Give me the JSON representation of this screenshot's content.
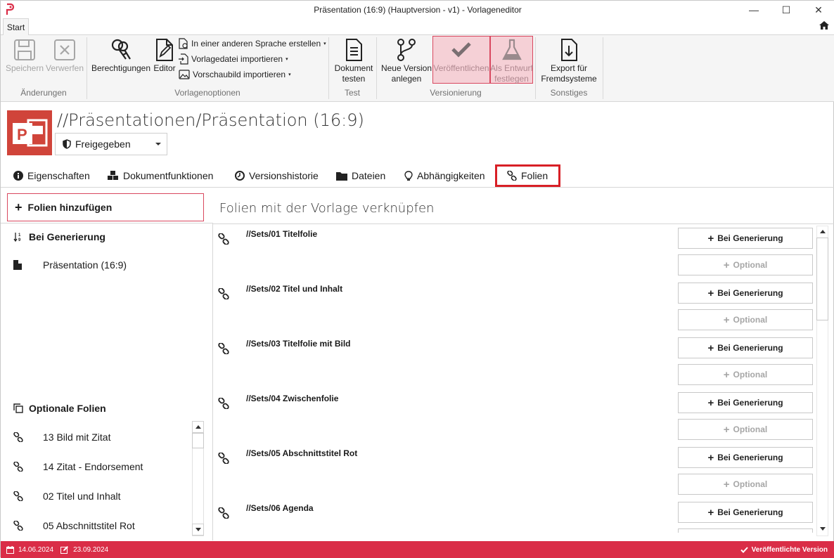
{
  "window": {
    "title": "Präsentation (16:9) (Hauptversion - v1) - Vorlageneditor",
    "minimize": "—",
    "maximize": "☐",
    "close": "✕"
  },
  "ribbon_tabs": {
    "start": "Start"
  },
  "ribbon": {
    "save": "Speichern",
    "discard": "Verwerfen",
    "group_changes": "Änderungen",
    "permissions": "Berechtigungen",
    "editor": "Editor",
    "other_language": "In einer anderen Sprache erstellen",
    "import_template": "Vorlagedatei importieren",
    "import_preview": "Vorschaubild importieren",
    "group_template_options": "Vorlagenoptionen",
    "test_doc_line1": "Dokument",
    "test_doc_line2": "testen",
    "group_test": "Test",
    "new_version_line1": "Neue Version",
    "new_version_line2": "anlegen",
    "publish": "Veröffentlichen",
    "draft_line1": "Als Entwurf",
    "draft_line2": "festlegen",
    "group_versioning": "Versionierung",
    "export_line1": "Export für",
    "export_line2": "Fremdsysteme",
    "group_misc": "Sonstiges"
  },
  "header": {
    "page_title": "//Präsentationen/Präsentation (16:9)",
    "status_value": "Freigegeben"
  },
  "doc_tabs": {
    "properties": "Eigenschaften",
    "doc_functions": "Dokumentfunktionen",
    "version_history": "Versionshistorie",
    "files": "Dateien",
    "dependencies": "Abhängigkeiten",
    "slides": "Folien"
  },
  "left": {
    "add_slides": "Folien hinzufügen",
    "on_generation_heading": "Bei Generierung",
    "on_generation_items": [
      "Präsentation (16:9)"
    ],
    "optional_heading": "Optionale Folien",
    "optional_items": [
      "13 Bild mit Zitat",
      "14 Zitat - Endorsement",
      "02 Titel und Inhalt",
      "05 Abschnittstitel Rot"
    ]
  },
  "right": {
    "title": "Folien mit der Vorlage verknüpfen",
    "btn_generation": "Bei Generierung",
    "btn_optional": "Optional",
    "slides": [
      "//Sets/01 Titelfolie",
      "//Sets/02 Titel und Inhalt",
      "//Sets/03 Titelfolie mit Bild",
      "//Sets/04 Zwischenfolie",
      "//Sets/05 Abschnittstitel Rot",
      "//Sets/06 Agenda"
    ]
  },
  "statusbar": {
    "created": "14.06.2024",
    "modified": "23.09.2024",
    "version_state": "Veröffentlichte Version"
  },
  "colors": {
    "accent": "#da2d47",
    "highlight_box": "#d81f26",
    "pressed_bg": "#f5d0d6",
    "doc_logo": "#d0443a"
  }
}
